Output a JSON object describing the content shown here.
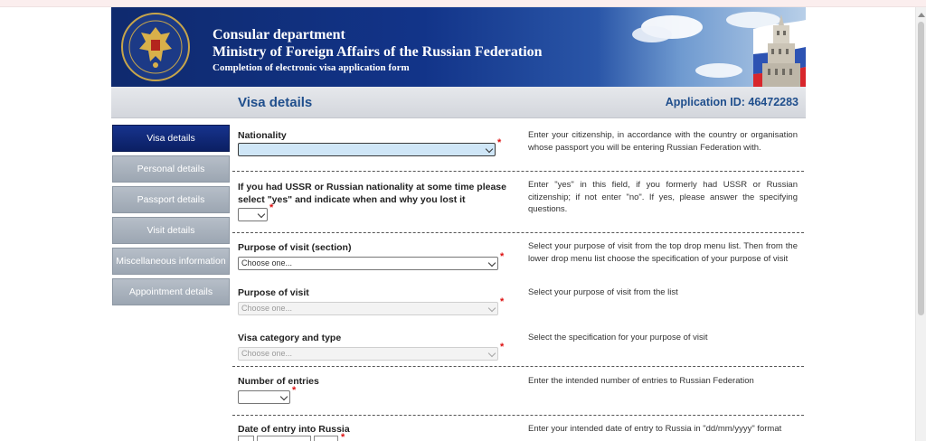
{
  "banner": {
    "line1": "Consular department",
    "line2": "Ministry of Foreign Affairs of the Russian Federation",
    "line3": "Completion of electronic visa application form"
  },
  "header": {
    "page_title": "Visa details",
    "application_id": "Application ID: 46472283"
  },
  "sidebar": {
    "items": [
      {
        "label": "Visa details",
        "active": true
      },
      {
        "label": "Personal details",
        "active": false
      },
      {
        "label": "Passport details",
        "active": false
      },
      {
        "label": "Visit details",
        "active": false
      },
      {
        "label": "Miscellaneous information",
        "active": false
      },
      {
        "label": "Appointment details",
        "active": false
      }
    ]
  },
  "form": {
    "required_mark": "*",
    "nationality": {
      "label": "Nationality",
      "value": "",
      "hint": "Enter your citizenship, in accordance with the country or organisation whose passport you will be entering Russian Federation with."
    },
    "ussr": {
      "label": "If you had USSR or Russian nationality at some time please select \"yes\" and indicate when and why you lost it",
      "value": "",
      "hint": "Enter \"yes\" in this field, if you formerly had USSR or Russian citizenship; if not enter \"no\". If yes, please answer the specifying questions."
    },
    "purpose_section": {
      "label": "Purpose of visit (section)",
      "value": "Choose one...",
      "hint": "Select your purpose of visit from the top drop menu list. Then from the lower drop menu list choose the specification of your purpose of visit"
    },
    "purpose": {
      "label": "Purpose of visit",
      "value": "Choose one...",
      "hint": "Select your purpose of visit from the list"
    },
    "visa_category": {
      "label": "Visa category and type",
      "value": "Choose one...",
      "hint": "Select the specification for your purpose of visit"
    },
    "entries": {
      "label": "Number of entries",
      "value": "",
      "hint": "Enter the intended number of entries to Russian Federation"
    },
    "entry_date": {
      "label": "Date of entry into Russia",
      "hint": "Enter your intended date of entry to Russia in \"dd/mm/yyyy\" format"
    }
  },
  "colors": {
    "banner_blue": "#123489",
    "active_nav": "#0b1f63",
    "inactive_nav": "#9ca6b2",
    "title_blue": "#1f4e8c",
    "required_red": "#dd1111",
    "nationality_fill": "#cfe6f7"
  }
}
